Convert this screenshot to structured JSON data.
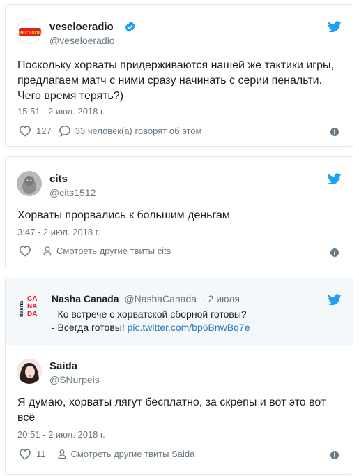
{
  "tweets": [
    {
      "name": "veseloeradio",
      "handle": "@veseloeradio",
      "verified": true,
      "avatar_text": "ВЕСЕЛОЕ",
      "text_lines": [
        "Поскольку хорваты придерживаются нашей же тактики игры,",
        "предлагаем матч с ними сразу начинать с серии пенальти.",
        "Чего время терять?)"
      ],
      "time": "15:51 - 2 июл. 2018 г.",
      "likes": "127",
      "replies_label": "33 человек(а) говорят об этом"
    },
    {
      "name": "cits",
      "handle": "@cits1512",
      "text_lines": [
        "Хорваты прорвались к большим деньгам"
      ],
      "time": "3:47 - 2 июл. 2018 г.",
      "profile_label": "Смотреть другие твиты cits"
    },
    {
      "quoted": {
        "name": "Nasha Canada",
        "handle": "@NashaCanada",
        "date": "· 2 июля",
        "logo_small": "nasha",
        "logo_big": [
          "CA",
          "NA",
          "DA"
        ],
        "line1": "- Ко встрече с хорватской сборной готовы?",
        "line2_prefix": "- Всегда готовы! ",
        "line2_link": "pic.twitter.com/bp6BnwBq7e"
      },
      "name": "Saida",
      "handle": "@SNurpeis",
      "text_lines": [
        "Я думаю, хорваты лягут бесплатно, за скрепы и вот это вот",
        "всё"
      ],
      "time": "20:51 - 2 июл. 2018 г.",
      "likes": "11",
      "profile_label": "Смотреть другие твиты Saida"
    }
  ],
  "colors": {
    "twitter_blue": "#1da1f2",
    "verified_blue": "#1da1f2",
    "text_secondary": "#697882",
    "link": "#2b7bb9",
    "brand_red": "#e31e24"
  },
  "icons": [
    "twitter-bird-icon",
    "verified-badge-icon",
    "heart-icon",
    "reply-bubble-icon",
    "person-icon",
    "info-icon"
  ]
}
